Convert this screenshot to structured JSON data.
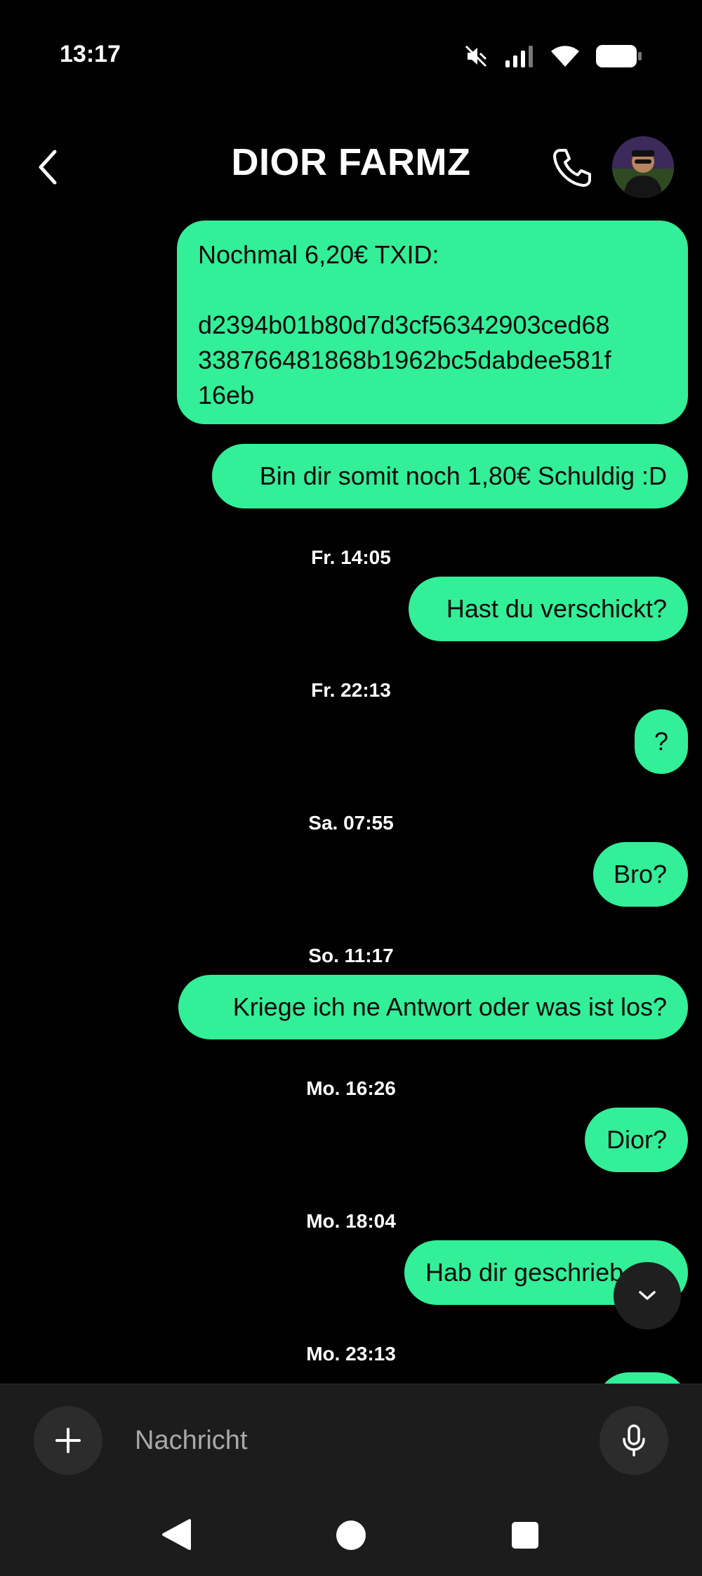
{
  "status_bar": {
    "time": "13:17",
    "icons": [
      "mute-icon",
      "signal-icon",
      "wifi-icon",
      "battery-icon"
    ]
  },
  "header": {
    "back_icon": "back-arrow-icon",
    "title": "DIOR FARMZ",
    "call_icon": "phone-icon",
    "avatar": "contact-avatar"
  },
  "colors": {
    "bubble": "#32EF98",
    "background": "#000000",
    "input_bar": "#1c1c1c"
  },
  "messages": [
    {
      "kind": "bubble",
      "lines": [
        "Nochmal 6,20€ TXID:",
        "",
        "d2394b01b80d7d3cf56342903ced68",
        "338766481868b1962bc5dabdee581f",
        "16eb"
      ]
    },
    {
      "kind": "bubble",
      "text": "Bin dir somit noch 1,80€ Schuldig :D"
    },
    {
      "kind": "stamp",
      "text": "Fr. 14:05"
    },
    {
      "kind": "bubble",
      "text": "Hast du verschickt?"
    },
    {
      "kind": "stamp",
      "text": "Fr. 22:13"
    },
    {
      "kind": "bubble",
      "text": "?"
    },
    {
      "kind": "stamp",
      "text": "Sa. 07:55"
    },
    {
      "kind": "bubble",
      "text": "Bro?"
    },
    {
      "kind": "stamp",
      "text": "So. 11:17"
    },
    {
      "kind": "bubble",
      "text": "Kriege ich ne Antwort oder was ist los?"
    },
    {
      "kind": "stamp",
      "text": "Mo. 16:26"
    },
    {
      "kind": "bubble",
      "text": "Dior?"
    },
    {
      "kind": "stamp",
      "text": "Mo. 18:04"
    },
    {
      "kind": "bubble",
      "text": "Hab dir geschrieb"
    },
    {
      "kind": "stamp",
      "text": "Mo. 23:13"
    }
  ],
  "scroll_button_icon": "chevron-down-icon",
  "composer": {
    "plus_icon": "plus-icon",
    "placeholder": "Nachricht",
    "value": "",
    "mic_icon": "microphone-icon"
  },
  "nav_bar": {
    "buttons": [
      "nav-back-icon",
      "nav-home-icon",
      "nav-recents-icon"
    ]
  }
}
